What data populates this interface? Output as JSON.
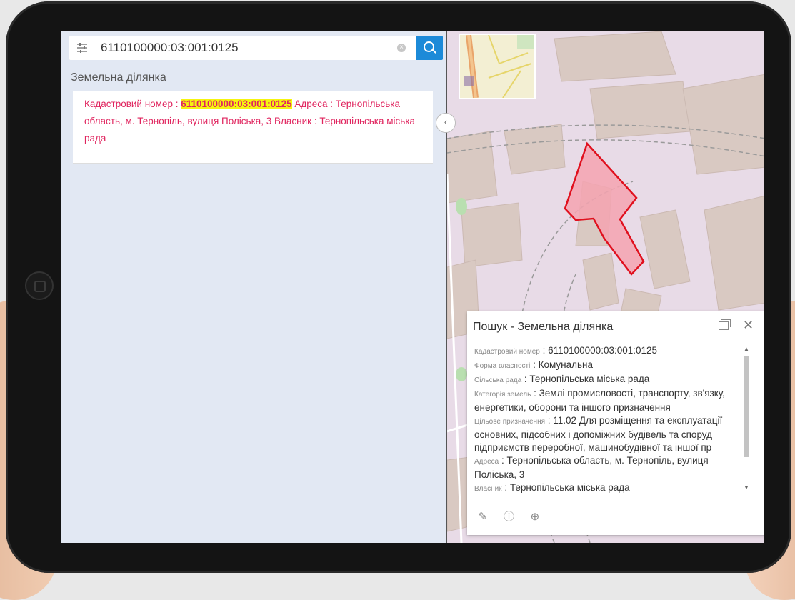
{
  "search": {
    "query": "6110100000:03:001:0125",
    "filter_icon": "sliders-icon",
    "clear_icon": "clear-icon",
    "search_icon": "search-icon"
  },
  "results": {
    "section_title": "Земельна ділянка",
    "item": {
      "prefix": "Кадастровий номер : ",
      "highlight": "6110100000:03:001:0125",
      "suffix": " Адреса : Тернопільська область, м. Тернопіль, вулиця Поліська, 3 Власник : Тернопільська міська рада"
    }
  },
  "popup": {
    "title": "Пошук - Земельна ділянка",
    "fields": [
      {
        "label": "Кадастровий номер",
        "value": "6110100000:03:001:0125"
      },
      {
        "label": "Форма власності",
        "value": "Комунальна"
      },
      {
        "label": "Сільська рада",
        "value": "Тернопільська міська рада"
      },
      {
        "label": "Категорія земель",
        "value": "Землі промисловості, транспорту, зв'язку, енергетики, оборони та іншого призначення"
      },
      {
        "label": "Цільове призначення",
        "value": "11.02 Для розміщення та експлуатації основних, підсобних і допоміжних будівель та споруд підприємств переробної, машинобудівної та іншої пр"
      },
      {
        "label": "Адреса",
        "value": "Тернопільська область, м. Тернопіль, вулиця Поліська, 3"
      },
      {
        "label": "Власник",
        "value": "Тернопільська міська рада"
      }
    ],
    "separator": " : ",
    "actions": [
      "edit-icon",
      "info-icon",
      "zoom-in-icon"
    ]
  },
  "colors": {
    "accent": "#1c8ad8",
    "result_text": "#e0245e",
    "highlight": "#f6f50f",
    "parcel_fill": "#f5a3b0",
    "parcel_stroke": "#e0101e"
  }
}
